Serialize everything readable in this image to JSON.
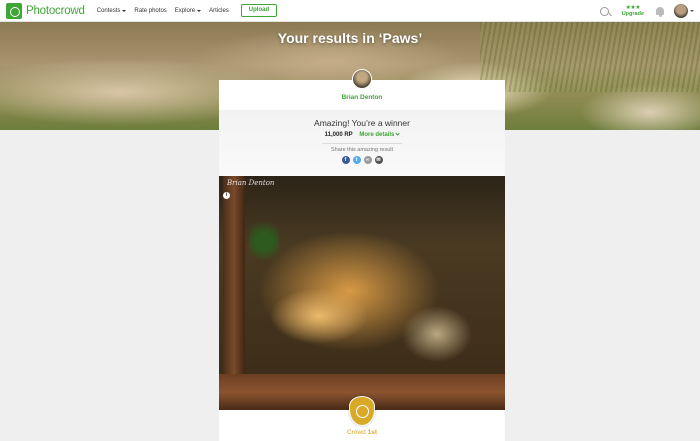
{
  "nav": {
    "logo_text": "Photocrowd",
    "menu": [
      {
        "label": "Contests",
        "has_caret": true
      },
      {
        "label": "Rate photos",
        "has_caret": false
      },
      {
        "label": "Explore",
        "has_caret": true
      },
      {
        "label": "Articles",
        "has_caret": false
      }
    ],
    "upload_label": "Upload",
    "upgrade_stars": "★★★",
    "upgrade_label": "Upgrade"
  },
  "hero": {
    "title": "Your results in ‘Paws’"
  },
  "result": {
    "user_name": "Brian Denton",
    "headline": "Amazing! You’re a winner",
    "rp_value": "11,000 RP",
    "more_details_label": "More details",
    "share_label": "Share this amazing result",
    "share_icons": [
      {
        "name": "facebook-icon",
        "glyph": "f",
        "color": "#3b5998"
      },
      {
        "name": "twitter-icon",
        "glyph": "t",
        "color": "#55acee"
      },
      {
        "name": "link-icon",
        "glyph": "∞",
        "color": "#999999"
      },
      {
        "name": "email-icon",
        "glyph": "✉",
        "color": "#555555"
      }
    ],
    "crowd_label": "Crowd",
    "crowd_rank": "1st"
  },
  "photo": {
    "watermark": "Brian Denton",
    "info_glyph": "i"
  },
  "colors": {
    "brand_green": "#3fa535",
    "gold": "#d9a928"
  }
}
